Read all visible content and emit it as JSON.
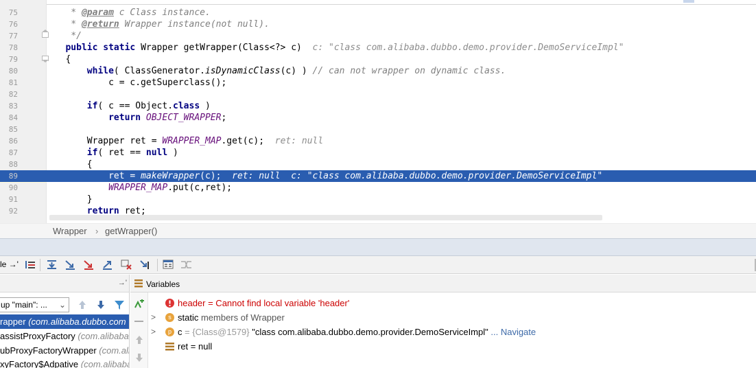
{
  "editor": {
    "lines": [
      {
        "n": "75",
        "segs": [
          {
            "t": "    * ",
            "c": "cm"
          },
          {
            "t": "@param",
            "c": "doctag"
          },
          {
            "t": " c ",
            "c": "cm"
          },
          {
            "t": "Class instance.",
            "c": "cm"
          }
        ]
      },
      {
        "n": "76",
        "segs": [
          {
            "t": "    * ",
            "c": "cm"
          },
          {
            "t": "@return",
            "c": "doctag"
          },
          {
            "t": " Wrapper instance(not null).",
            "c": "cm"
          }
        ]
      },
      {
        "n": "77",
        "segs": [
          {
            "t": "    */",
            "c": "cm"
          }
        ]
      },
      {
        "n": "78",
        "segs": [
          {
            "t": "   public static ",
            "c": "kw"
          },
          {
            "t": "Wrapper getWrapper(Class<?> c)  ",
            "c": ""
          },
          {
            "t": "c: \"class com.alibaba.dubbo.demo.provider.DemoServiceImpl\"",
            "c": "hint"
          }
        ]
      },
      {
        "n": "79",
        "segs": [
          {
            "t": "   {",
            "c": ""
          }
        ]
      },
      {
        "n": "80",
        "segs": [
          {
            "t": "       while",
            "c": "kw"
          },
          {
            "t": "( ClassGenerator.",
            "c": ""
          },
          {
            "t": "isDynamicClass",
            "c": "st"
          },
          {
            "t": "(c) ) ",
            "c": ""
          },
          {
            "t": "// can not wrapper on dynamic class.",
            "c": "cm"
          }
        ]
      },
      {
        "n": "81",
        "segs": [
          {
            "t": "           c = c.getSuperclass();",
            "c": ""
          }
        ]
      },
      {
        "n": "82",
        "segs": []
      },
      {
        "n": "83",
        "segs": [
          {
            "t": "       if",
            "c": "kw"
          },
          {
            "t": "( c == Object.",
            "c": ""
          },
          {
            "t": "class",
            "c": "kw"
          },
          {
            "t": " )",
            "c": ""
          }
        ]
      },
      {
        "n": "84",
        "segs": [
          {
            "t": "           return ",
            "c": "kw"
          },
          {
            "t": "OBJECT_WRAPPER",
            "c": "sf"
          },
          {
            "t": ";",
            "c": ""
          }
        ]
      },
      {
        "n": "85",
        "segs": []
      },
      {
        "n": "86",
        "segs": [
          {
            "t": "       Wrapper ret = ",
            "c": ""
          },
          {
            "t": "WRAPPER_MAP",
            "c": "sf"
          },
          {
            "t": ".get(c);  ",
            "c": ""
          },
          {
            "t": "ret: null",
            "c": "hint"
          }
        ]
      },
      {
        "n": "87",
        "segs": [
          {
            "t": "       if",
            "c": "kw"
          },
          {
            "t": "( ret == ",
            "c": ""
          },
          {
            "t": "null",
            "c": "kw"
          },
          {
            "t": " )",
            "c": ""
          }
        ]
      },
      {
        "n": "88",
        "segs": [
          {
            "t": "       {",
            "c": ""
          }
        ]
      },
      {
        "n": "89",
        "segs": [
          {
            "t": "           ret = ",
            "c": ""
          },
          {
            "t": "makeWrapper",
            "c": "st"
          },
          {
            "t": "(c);  ",
            "c": ""
          },
          {
            "t": "ret: null  c: \"class com.alibaba.dubbo.demo.provider.DemoServiceImpl\"",
            "c": "hint"
          }
        ]
      },
      {
        "n": "90",
        "segs": [
          {
            "t": "           ",
            "c": ""
          },
          {
            "t": "WRAPPER_MAP",
            "c": "sf"
          },
          {
            "t": ".put(c,ret);",
            "c": ""
          }
        ]
      },
      {
        "n": "91",
        "segs": [
          {
            "t": "       }",
            "c": ""
          }
        ]
      },
      {
        "n": "92",
        "segs": [
          {
            "t": "       return ",
            "c": "kw"
          },
          {
            "t": "ret;",
            "c": ""
          }
        ]
      }
    ]
  },
  "breadcrumb": {
    "class_name": "Wrapper",
    "separator": "›",
    "method_name": "getWrapper()"
  },
  "debug_toolbar": {
    "left_text": "le  →'"
  },
  "frames": {
    "thread_select": "up \"main\": ...",
    "items": [
      {
        "name": "rapper",
        "pkg": " (com.alibaba.dubbo.com"
      },
      {
        "name": "assistProxyFactory",
        "pkg": " (com.alibaba.d"
      },
      {
        "name": "ubProxyFactoryWrapper",
        "pkg": " (com.ali"
      },
      {
        "name": "xyFactory$Adpative",
        "pkg": " (com.alibaba"
      }
    ]
  },
  "variables": {
    "title": "Variables",
    "items": [
      {
        "name": "header",
        "rest": " = Cannot find local variable 'header'"
      },
      {
        "prefix": "static",
        "rest": " members of Wrapper"
      },
      {
        "name": "c",
        "type": " = {Class@1579}",
        "value": " \"class com.alibaba.dubbo.demo.provider.DemoServiceImpl\"",
        "link": "... Navigate"
      },
      {
        "name": "ret",
        "rest": " = null"
      }
    ]
  },
  "colors": {
    "current_line": "#2a5db0",
    "keyword": "#000080",
    "static_field": "#660e7a",
    "error": "#cc0000"
  }
}
